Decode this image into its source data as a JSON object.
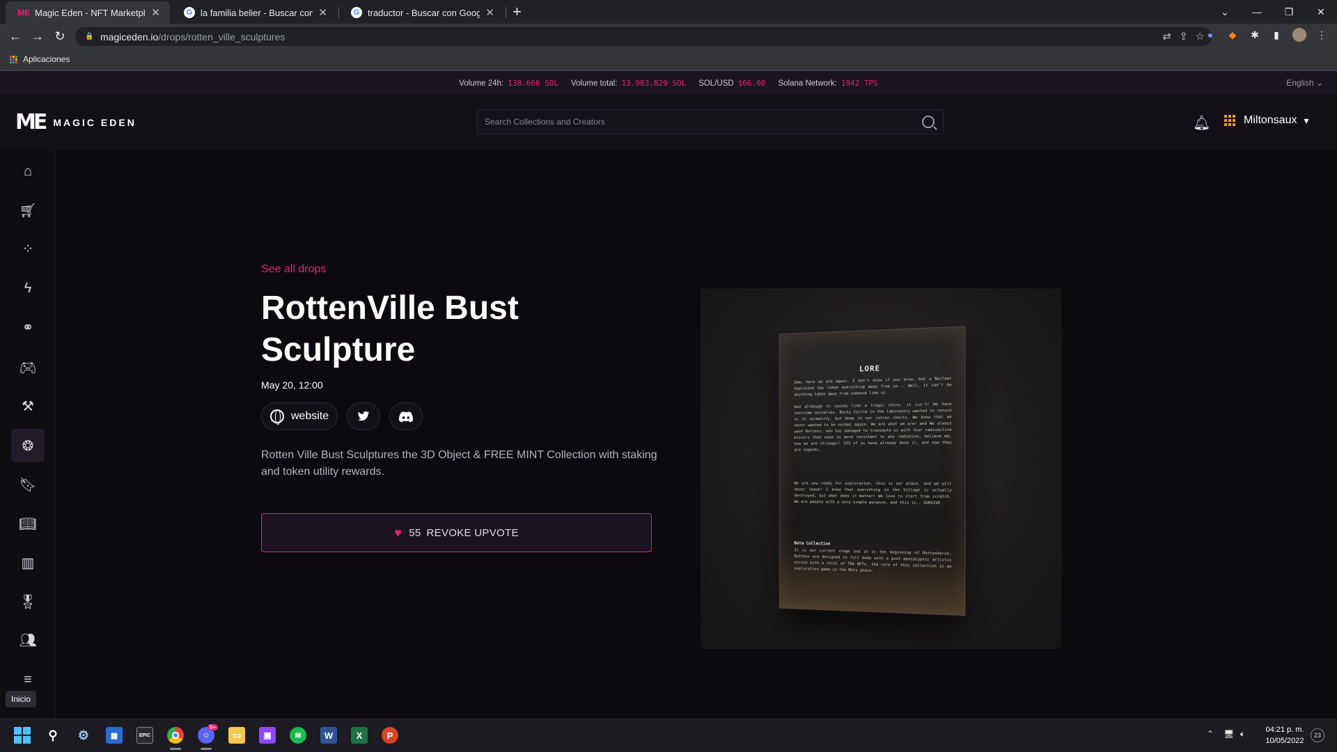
{
  "browser": {
    "tabs": [
      {
        "title": "Magic Eden - NFT Marketplace",
        "active": true
      },
      {
        "title": "la familia belier - Buscar con Goo"
      },
      {
        "title": "traductor - Buscar con Google"
      }
    ],
    "url_host": "magiceden.io",
    "url_path": "/drops/rotten_ville_sculptures",
    "bookmarks_label": "Aplicaciones"
  },
  "stats": {
    "volume_24h_label": "Volume 24h:",
    "volume_24h_value": "138.666 SOL",
    "volume_total_label": "Volume total:",
    "volume_total_value": "13.983.829 SOL",
    "sol_usd_label": "SOL/USD",
    "sol_usd_value": "$66.00",
    "network_label": "Solana Network:",
    "network_value": "1942 TPS",
    "language": "English"
  },
  "header": {
    "logo_text": "MAGIC EDEN",
    "search_placeholder": "Search Collections and Creators",
    "username": "Miltonsaux"
  },
  "sidebar": {
    "items": [
      {
        "name": "home",
        "icon": "home-icon"
      },
      {
        "name": "marketplace",
        "icon": "cart-icon"
      },
      {
        "name": "launchpad",
        "icon": "sparkle-icon"
      },
      {
        "name": "popular",
        "icon": "bolt-icon"
      },
      {
        "name": "explore",
        "icon": "binoculars-icon"
      },
      {
        "name": "games",
        "icon": "gamepad-icon"
      },
      {
        "name": "auctions",
        "icon": "gavel-icon"
      },
      {
        "name": "drops",
        "icon": "balloon-icon",
        "active": true
      },
      {
        "name": "watchlist",
        "icon": "bookmark-icon"
      },
      {
        "name": "learn",
        "icon": "book-icon"
      },
      {
        "name": "stats",
        "icon": "bar-chart-icon"
      },
      {
        "name": "rewards",
        "icon": "award-icon"
      },
      {
        "name": "community",
        "icon": "users-icon"
      },
      {
        "name": "menu",
        "icon": "menu-icon"
      }
    ],
    "tooltip": "Inicio"
  },
  "drop": {
    "see_all": "See all drops",
    "title": "RottenVille Bust Sculpture",
    "date": "May 20, 12:00",
    "website_label": "website",
    "description": "Rotten Ville Bust Sculptures the 3D Object & FREE MINT Collection with staking and token utility rewards.",
    "upvote_count": "55",
    "upvote_label": "REVOKE UPVOTE"
  },
  "artwork": {
    "lore_title": "LORE",
    "lore_p1": "Umm, here we are again. I don't know if you know, but a Nuclear explosion has taken everything away from us... Well, it can't be anything taken away from someone like us.",
    "lore_p2": "And although it sounds like a tragic story, it isn't! We have overcome ourselves. Becky Currie in the laboratory wanted to return us to normality, but deep in our rotten chests, We know that we never wanted to be normal again. We are what we are! and We always want Rottens, who has managed to transmute us with four radioactive elixirs that make us more resistant to any radiation, believe me, now we are stronger! 333 of us have already done it, and now they are legends.",
    "lore_p3": "We are now ready for exploration, this is our place, and we will never leave! I know that everything in the Village is actually destroyed, but what does it matter! We love to start from scratch. We are people with a very simple purpose, and this is.. SURVIVE.",
    "beta_title": "Beta Collection",
    "beta_p": "It is our current stage and it is the beginning of RottenVerse. Rottens are designed to full body with a post-apocalyptic artistic vision with a total of TBA NFTs, the core of this collection is an exploration game in the Beta phase."
  },
  "taskbar": {
    "time": "04:21 p. m.",
    "date": "10/05/2022",
    "notifications": "23",
    "discord_badge": "9+"
  },
  "colors": {
    "accent": "#e42575",
    "background": "#0c0a0e",
    "header": "#120f16"
  }
}
